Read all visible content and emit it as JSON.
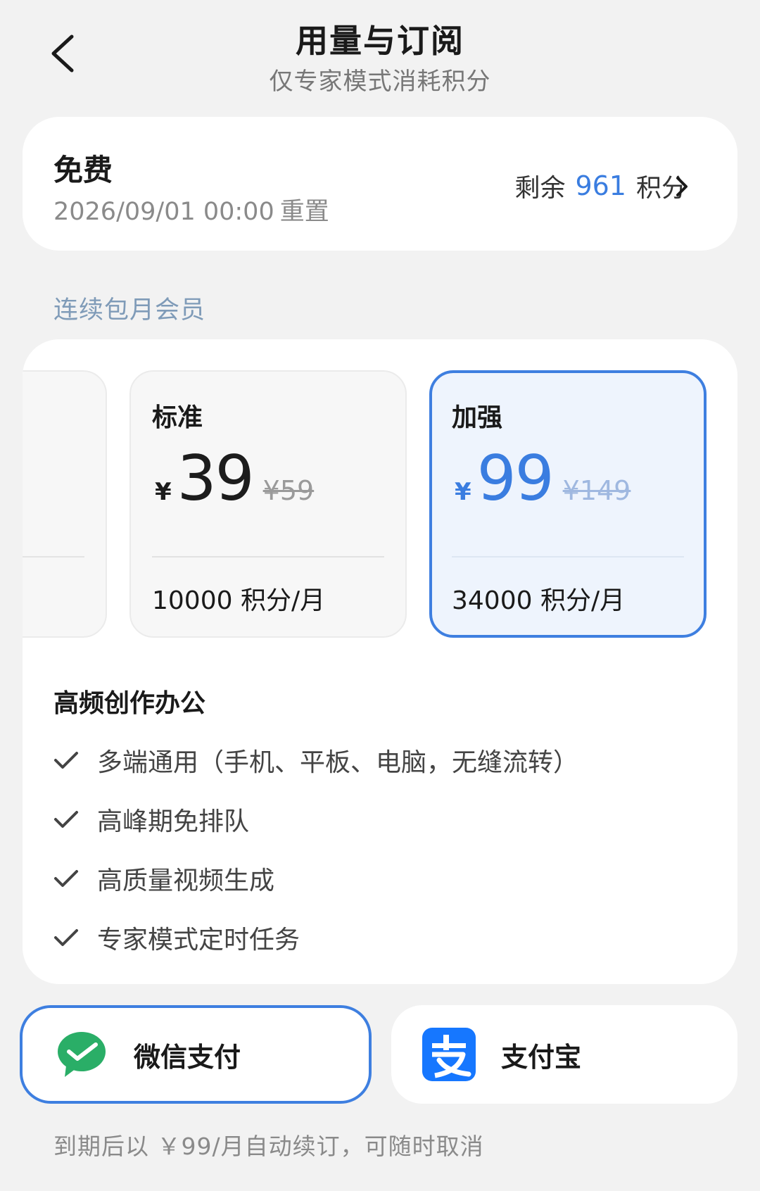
{
  "header": {
    "title": "用量与订阅",
    "subtitle": "仅专家模式消耗积分"
  },
  "plan": {
    "name": "免费",
    "reset_time": "2026/09/01 00:00",
    "reset_label": "重置",
    "remaining_prefix": "剩余",
    "remaining_value": "961",
    "remaining_unit": "积分"
  },
  "section_label": "连续包月会员",
  "tiers": [
    {
      "name": "标准",
      "currency": "¥",
      "price": "39",
      "original_price": "¥59",
      "credits": "10000 积分/月"
    },
    {
      "name": "加强",
      "currency": "¥",
      "price": "99",
      "original_price": "¥149",
      "credits": "34000 积分/月"
    }
  ],
  "features": {
    "title": "高频创作办公",
    "items": [
      "多端通用（手机、平板、电脑，无缝流转）",
      "高峰期免排队",
      "高质量视频生成",
      "专家模式定时任务"
    ]
  },
  "payment": {
    "wechat_label": "微信支付",
    "alipay_label": "支付宝",
    "selected": "wechat"
  },
  "footnote": "到期后以 ￥99/月自动续订，可随时取消",
  "colors": {
    "accent": "#3a7de0",
    "background": "#f2f2f2",
    "wechat_green": "#2aae67",
    "alipay_blue": "#1677ff"
  }
}
